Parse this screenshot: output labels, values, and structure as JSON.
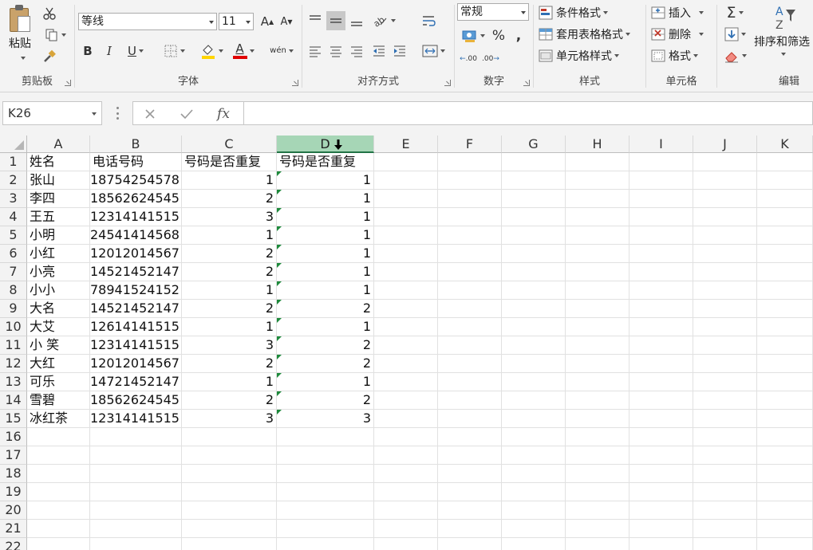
{
  "ribbon": {
    "clipboard": {
      "paste_label": "粘贴",
      "group_label": "剪贴板"
    },
    "font": {
      "font_name": "等线",
      "font_size": "11",
      "grow_label": "A",
      "shrink_label": "A",
      "bold": "B",
      "italic": "I",
      "underline": "U",
      "font_color_label": "A",
      "phonetic_label": "wén",
      "group_label": "字体"
    },
    "alignment": {
      "group_label": "对齐方式"
    },
    "number": {
      "format": "常规",
      "percent": "%",
      "comma": ",",
      "inc_decimal": ".00",
      "dec_decimal": ".00",
      "group_label": "数字"
    },
    "styles": {
      "conditional": "条件格式",
      "table_format": "套用表格格式",
      "cell_styles": "单元格样式",
      "group_label": "样式"
    },
    "cells": {
      "insert": "插入",
      "delete": "删除",
      "format": "格式",
      "group_label": "单元格"
    },
    "editing": {
      "sigma": "Σ",
      "sort_filter": "排序和筛选",
      "group_label": "编辑"
    }
  },
  "formula_bar": {
    "name_box": "K26",
    "fx": "fx",
    "formula": ""
  },
  "sheet": {
    "columns": [
      "A",
      "B",
      "C",
      "D",
      "E",
      "F",
      "G",
      "H",
      "I",
      "J",
      "K"
    ],
    "selected_column": "D",
    "rows": [
      [
        "姓名",
        "电话号码",
        "号码是否重复",
        "号码是否重复"
      ],
      [
        "张山",
        "18754254578",
        "1",
        "1"
      ],
      [
        "李四",
        "18562624545",
        "2",
        "1"
      ],
      [
        "王五",
        "12314141515",
        "3",
        "1"
      ],
      [
        "小明",
        "24541414568",
        "1",
        "1"
      ],
      [
        "小红",
        "12012014567",
        "2",
        "1"
      ],
      [
        "小亮",
        "14521452147",
        "2",
        "1"
      ],
      [
        "小小",
        "78941524152",
        "1",
        "1"
      ],
      [
        "大名",
        "14521452147",
        "2",
        "2"
      ],
      [
        "大艾",
        "12614141515",
        "1",
        "1"
      ],
      [
        "小 笑",
        "12314141515",
        "3",
        "2"
      ],
      [
        "大红",
        "12012014567",
        "2",
        "2"
      ],
      [
        "可乐",
        "14721452147",
        "1",
        "1"
      ],
      [
        "雪碧",
        "18562624545",
        "2",
        "2"
      ],
      [
        "冰红茶",
        "12314141515",
        "3",
        "3"
      ]
    ],
    "row_numbers": [
      "1",
      "2",
      "3",
      "4",
      "5",
      "6",
      "7",
      "8",
      "9",
      "10",
      "11",
      "12",
      "13",
      "14",
      "15",
      "16",
      "17",
      "18",
      "19",
      "20",
      "21",
      "22"
    ]
  },
  "colors": {
    "accent": "#217346",
    "selected_header": "#a6d6b6",
    "error_triangle": "#1e8a3c"
  }
}
